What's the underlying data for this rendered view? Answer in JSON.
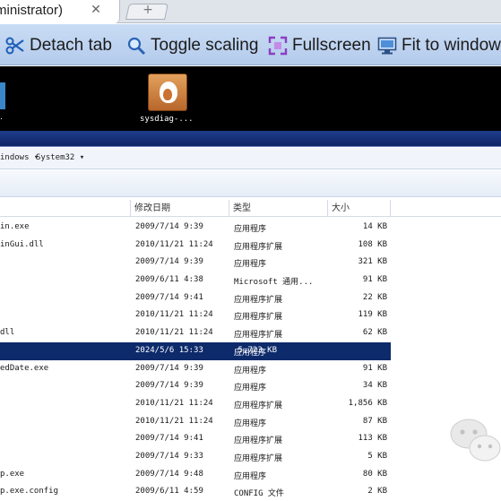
{
  "browser": {
    "tab_title": "ministrator)",
    "close_glyph": "✕",
    "newtab_glyph": "+"
  },
  "toolbar": {
    "detach_label": "Detach tab",
    "scaling_label": "Toggle scaling",
    "fullscreen_label": "Fullscreen",
    "fit_label": "Fit to window"
  },
  "desktop": {
    "left_label": ".",
    "app_label": "sysdiag-..."
  },
  "address": {
    "crumb1": "indows ▾",
    "crumb2": "System32 ▾"
  },
  "columns": {
    "date": "修改日期",
    "type": "类型",
    "size": "大小"
  },
  "files": [
    {
      "name": "in.exe",
      "date": "2009/7/14 9:39",
      "type": "应用程序",
      "size": "14 KB"
    },
    {
      "name": "inGui.dll",
      "date": "2010/11/21 11:24",
      "type": "应用程序扩展",
      "size": "108 KB"
    },
    {
      "name": "",
      "date": "2009/7/14 9:39",
      "type": "应用程序",
      "size": "321 KB"
    },
    {
      "name": "",
      "date": "2009/6/11 4:38",
      "type": "Microsoft 通用...",
      "size": "91 KB"
    },
    {
      "name": "",
      "date": "2009/7/14 9:41",
      "type": "应用程序扩展",
      "size": "22 KB"
    },
    {
      "name": "",
      "date": "2010/11/21 11:24",
      "type": "应用程序扩展",
      "size": "119 KB"
    },
    {
      "name": "dll",
      "date": "2010/11/21 11:24",
      "type": "应用程序扩展",
      "size": "62 KB"
    },
    {
      "name": "",
      "date": "2024/5/6 15:33",
      "type": "应用程序",
      "size": "5,723 KB",
      "selected": true
    },
    {
      "name": "edDate.exe",
      "date": "2009/7/14 9:39",
      "type": "应用程序",
      "size": "91 KB"
    },
    {
      "name": "",
      "date": "2009/7/14 9:39",
      "type": "应用程序",
      "size": "34 KB"
    },
    {
      "name": "",
      "date": "2010/11/21 11:24",
      "type": "应用程序扩展",
      "size": "1,856 KB"
    },
    {
      "name": "",
      "date": "2010/11/21 11:24",
      "type": "应用程序",
      "size": "87 KB"
    },
    {
      "name": "",
      "date": "2009/7/14 9:41",
      "type": "应用程序扩展",
      "size": "113 KB"
    },
    {
      "name": "",
      "date": "2009/7/14 9:33",
      "type": "应用程序扩展",
      "size": "5 KB"
    },
    {
      "name": "p.exe",
      "date": "2009/7/14 9:48",
      "type": "应用程序",
      "size": "80 KB"
    },
    {
      "name": "p.exe.config",
      "date": "2009/6/11 4:59",
      "type": "CONFIG 文件",
      "size": "2 KB"
    }
  ],
  "colors": {
    "selection": "#0d2a6b",
    "toolbar": "#c9dcf4",
    "window_bar": "#1f3d8a"
  }
}
